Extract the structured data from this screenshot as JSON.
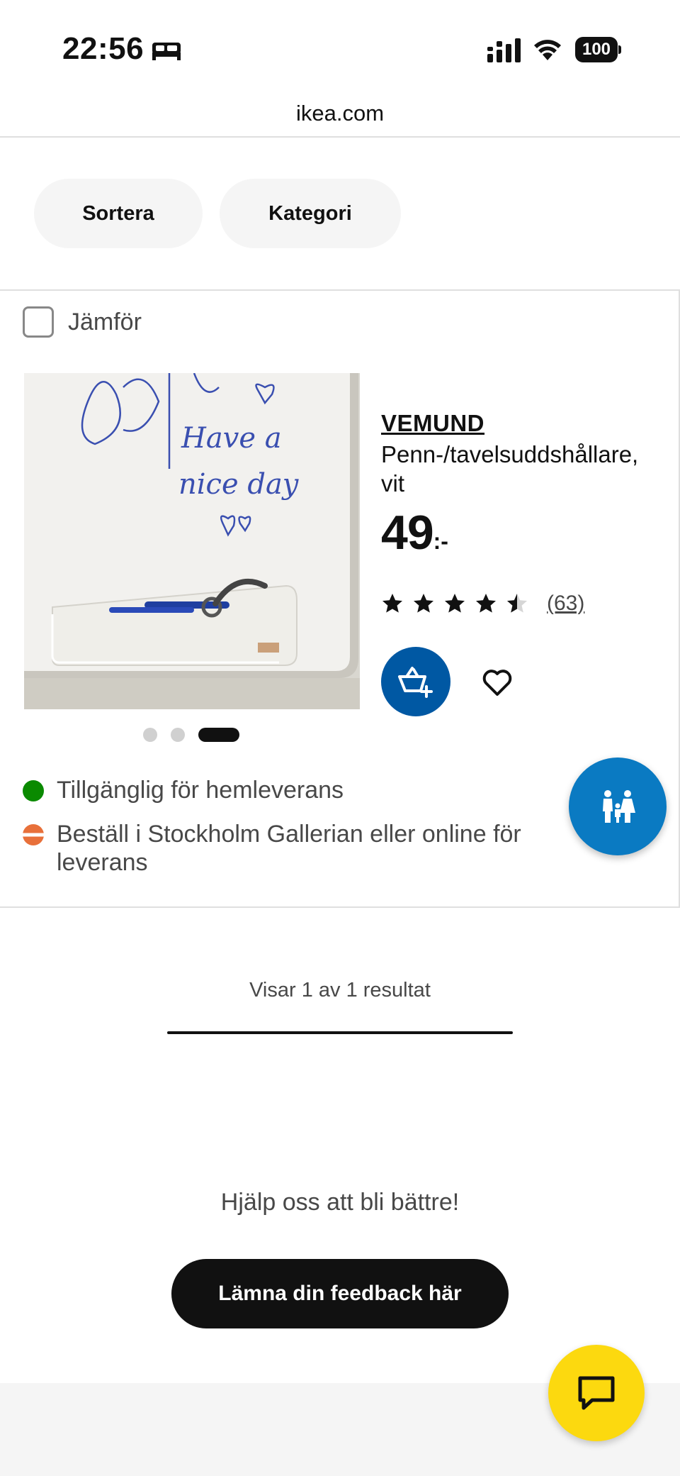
{
  "status_bar": {
    "time": "22:56",
    "battery": "100"
  },
  "browser": {
    "url": "ikea.com"
  },
  "filters": {
    "sort_label": "Sortera",
    "category_label": "Kategori"
  },
  "product": {
    "compare_label": "Jämför",
    "name": "VEMUND",
    "description": "Penn-/tavelsuddshållare, vit",
    "price_integer": "49",
    "price_suffix": ":-",
    "rating": 4.5,
    "review_count": "(63)",
    "image_dots": {
      "count": 3,
      "active_index": 2
    },
    "image_handwriting": [
      "Have a",
      "nice day"
    ],
    "availability": [
      {
        "text": "Tillgänglig för hemleverans",
        "status_color": "#0a8a00"
      },
      {
        "text": "Beställ i Stockholm Gallerian eller online för leverans",
        "status_color": "#e8703a"
      }
    ],
    "icons": {
      "cart": "add-to-cart-icon",
      "favourite": "heart-icon"
    }
  },
  "results": {
    "text": "Visar 1 av 1 resultat"
  },
  "feedback": {
    "help_text": "Hjälp oss att bli bättre!",
    "button_label": "Lämna din feedback här"
  },
  "fabs": {
    "family": "family-icon",
    "chat": "chat-icon"
  },
  "colors": {
    "ikea_blue": "#0058a3",
    "family_blue": "#0a7ac2",
    "ikea_yellow": "#fcd90f"
  }
}
